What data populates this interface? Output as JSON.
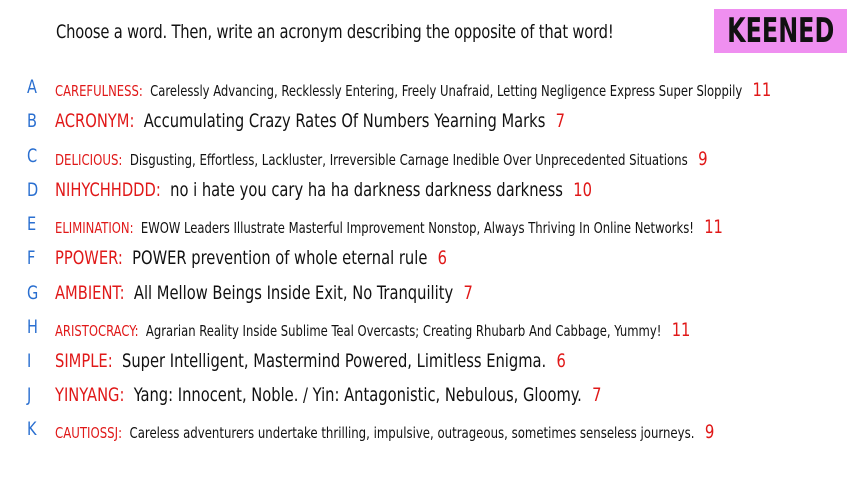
{
  "header": {
    "prompt": "Choose a word. Then, write an acronym describing the opposite of that word!",
    "badge": "KEENED",
    "badge_color": "#ef8ff0"
  },
  "colors": {
    "letter": "#2a6fd0",
    "word": "#e01818",
    "count": "#e01818",
    "text": "#111111"
  },
  "rows": [
    {
      "letter": "A",
      "word": "CAREFULNESS",
      "acronym": "Carelessly Advancing, Recklessly Entering, Freely Unafraid, Letting Negligence Express Super Sloppily",
      "count": "11"
    },
    {
      "letter": "B",
      "word": "ACRONYM",
      "acronym": "Accumulating Crazy Rates Of Numbers Yearning Marks",
      "count": "7"
    },
    {
      "letter": "C",
      "word": "DELICIOUS",
      "acronym": "Disgusting, Effortless, Lackluster, Irreversible Carnage Inedible Over Unprecedented Situations",
      "count": "9"
    },
    {
      "letter": "D",
      "word": "NIHYCHHDDD",
      "acronym": "no i hate you cary ha ha darkness darkness darkness",
      "count": "10"
    },
    {
      "letter": "E",
      "word": "ELIMINATION",
      "acronym": "EWOW Leaders Illustrate Masterful Improvement Nonstop, Always Thriving In Online Networks!",
      "count": "11"
    },
    {
      "letter": "F",
      "word": "PPOWER",
      "acronym": "POWER prevention of whole eternal rule",
      "count": "6"
    },
    {
      "letter": "G",
      "word": "AMBIENT",
      "acronym": "All Mellow Beings Inside Exit, No Tranquility",
      "count": "7"
    },
    {
      "letter": "H",
      "word": "ARISTOCRACY",
      "acronym": "Agrarian Reality Inside Sublime Teal Overcasts; Creating Rhubarb And Cabbage, Yummy!",
      "count": "11"
    },
    {
      "letter": "I",
      "word": "SIMPLE",
      "acronym": "Super Intelligent, Mastermind Powered, Limitless Enigma.",
      "count": "6"
    },
    {
      "letter": "J",
      "word": "YINYANG",
      "acronym": "Yang: Innocent, Noble. / Yin: Antagonistic, Nebulous, Gloomy.",
      "count": "7"
    },
    {
      "letter": "K",
      "word": "CAUTIOSSJ",
      "acronym": "Careless adventurers undertake thrilling, impulsive, outrageous, sometimes senseless journeys.",
      "count": "9"
    }
  ]
}
